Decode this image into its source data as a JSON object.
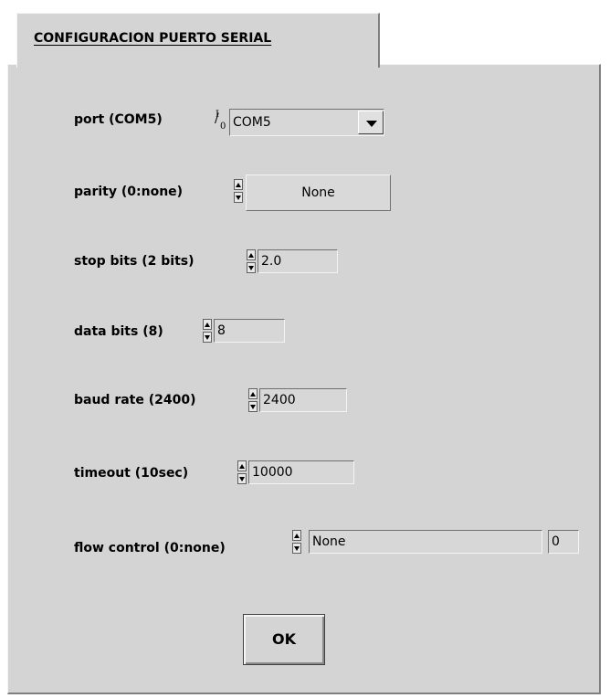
{
  "tab": {
    "label": "CONFIGURACION PUERTO SERIAL"
  },
  "fields": {
    "port": {
      "label": "port (COM5)",
      "value": "COM5",
      "icon_top": "I",
      "icon_bottom": "0"
    },
    "parity": {
      "label": "parity (0:none)",
      "value": "None"
    },
    "stop_bits": {
      "label": "stop bits (2 bits)",
      "value": "2.0"
    },
    "data_bits": {
      "label": "data bits (8)",
      "value": "8"
    },
    "baud_rate": {
      "label": "baud rate (2400)",
      "value": "2400"
    },
    "timeout": {
      "label": "timeout (10sec)",
      "value": "10000"
    },
    "flow_control": {
      "label": "flow control (0:none)",
      "value": "None",
      "index": "0"
    }
  },
  "ok_button": {
    "label": "OK"
  },
  "icons": {
    "port_resource": "io-resource-icon",
    "dropdown": "triangle-down-icon",
    "spin": "increment-decrement-arrows-icon"
  },
  "colors": {
    "panel": "#d4d4d4",
    "field": "#d7d7d7"
  }
}
